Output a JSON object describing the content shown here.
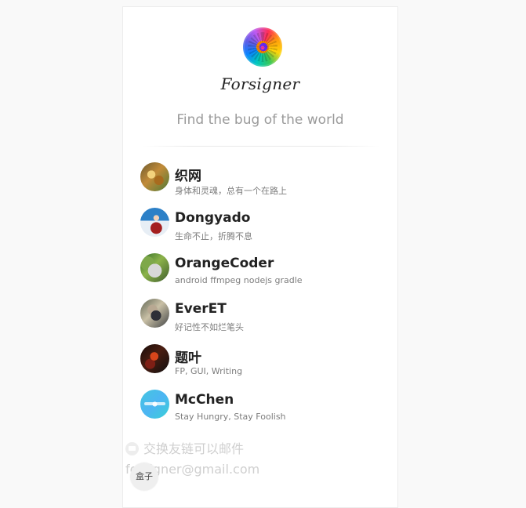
{
  "header": {
    "title": "Forsigner",
    "subtitle": "Find the bug of the world",
    "avatar_icon": "rainbow-rose-avatar"
  },
  "friends": [
    {
      "name": "织网",
      "description": "身体和灵魂，总有一个在路上",
      "avatar_icon": "nature-avatar"
    },
    {
      "name": "Dongyado",
      "description": "生命不止，折腾不息",
      "avatar_icon": "person-avatar"
    },
    {
      "name": "OrangeCoder",
      "description": "android ffmpeg nodejs gradle",
      "avatar_icon": "husky-avatar"
    },
    {
      "name": "EverET",
      "description": "好记性不如烂笔头",
      "avatar_icon": "anime-avatar"
    },
    {
      "name": "题叶",
      "description": "FP, GUI, Writing",
      "avatar_icon": "leaves-avatar"
    },
    {
      "name": "McChen",
      "description": "Stay Hungry, Stay Foolish",
      "avatar_icon": "cyan-logo-avatar"
    }
  ],
  "contact": {
    "line1": "交换友链可以邮件",
    "line2": "forsigner@gmail.com",
    "mail_icon": "mail-icon"
  },
  "box_button": {
    "label": "盒子"
  },
  "colors": {
    "page_background": "#f9f9f9",
    "card_background": "#ffffff",
    "name_text": "#222222",
    "muted_text": "#7d7d7d",
    "contact_text": "#cfcfcf"
  }
}
